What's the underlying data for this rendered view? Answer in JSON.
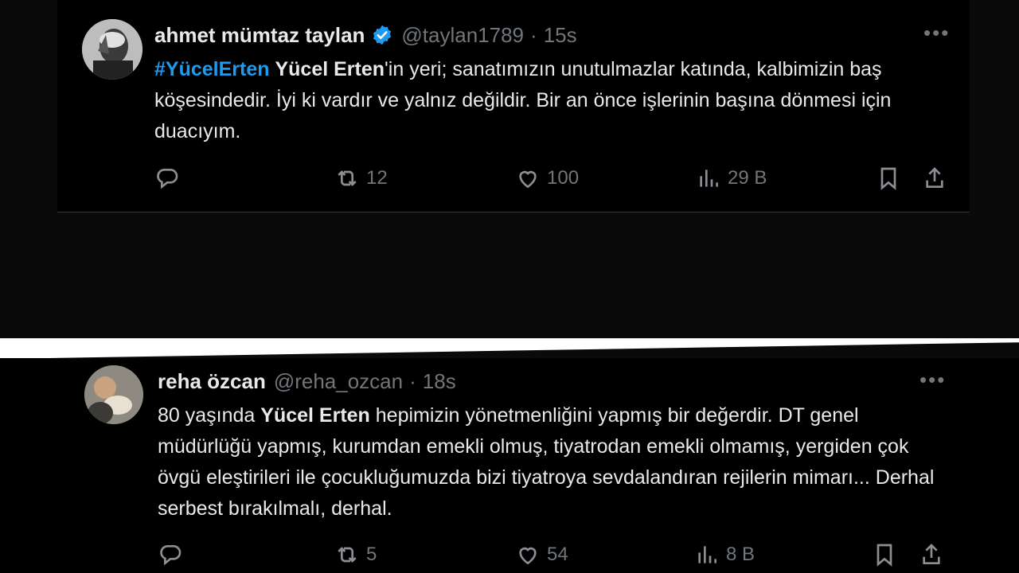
{
  "tweet1": {
    "display_name": "ahmet mümtaz taylan",
    "handle": "@taylan1789",
    "separator": "·",
    "time": "15s",
    "hashtag": "#YücelErten",
    "bold_name": "Yücel Erten",
    "text_rest": "'in yeri; sanatımızın unutulmazlar katında, kalbimizin baş köşesindedir. İyi ki vardır ve yalnız değildir. Bir an önce işlerinin başına dönmesi için duacıyım.",
    "retweets": "12",
    "likes": "100",
    "views": "29 B",
    "more": "•••"
  },
  "tweet2": {
    "display_name": "reha özcan",
    "handle": "@reha_ozcan",
    "separator": "·",
    "time": "18s",
    "text_before": "80 yaşında ",
    "bold_name": "Yücel Erten",
    "text_rest": " hepimizin yönetmenliğini yapmış bir değerdir. DT genel müdürlüğü yapmış, kurumdan emekli olmuş, tiyatrodan emekli olmamış, yergiden çok övgü eleştirileri ile çocukluğumuzda bizi tiyatroya sevdalandıran rejilerin mimarı... Derhal serbest bırakılmalı, derhal.",
    "retweets": "5",
    "likes": "54",
    "views": "8 B",
    "more": "•••"
  },
  "colors": {
    "accent": "#1d9bf0",
    "muted": "#71767b",
    "text": "#e7e9ea",
    "background": "#000000"
  },
  "icons": [
    "reply-icon",
    "retweet-icon",
    "like-icon",
    "views-icon",
    "bookmark-icon",
    "share-icon",
    "verified-badge-icon",
    "more-icon"
  ]
}
